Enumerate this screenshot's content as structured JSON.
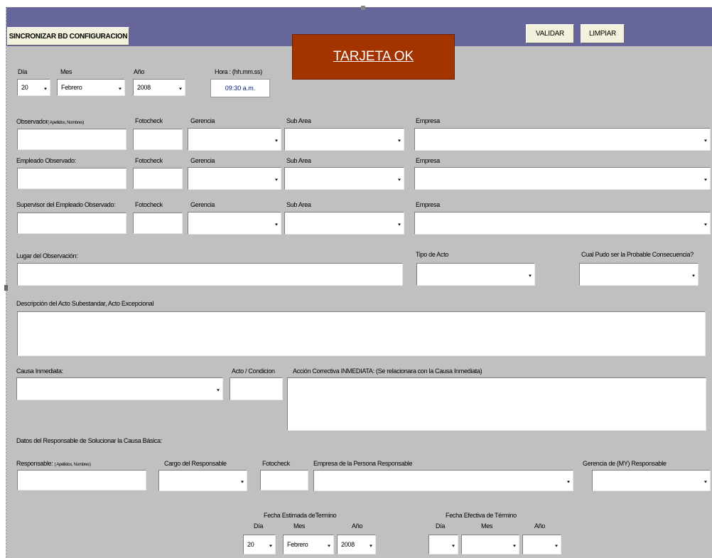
{
  "toolbar": {
    "sync_label": "SINCRONIZAR BD CONFIGURACION",
    "validate_label": "VALIDAR",
    "clear_label": "LIMPIAR",
    "status_banner": "TARJETA OK"
  },
  "date": {
    "day_label": "Día",
    "month_label": "Mes",
    "year_label": "Año",
    "time_label": "Hora : (hh.mm.ss)",
    "day_value": "20",
    "month_value": "Febrero",
    "year_value": "2008",
    "time_value": "09:30 a.m."
  },
  "observer": {
    "name_label_main": "Observador",
    "name_label_hint": "( Apellidos, Nombres)",
    "fotocheck_label": "Fotocheck",
    "gerencia_label": "Gerencia",
    "subarea_label": "Sub Area",
    "empresa_label": "Empresa"
  },
  "employee": {
    "name_label": "Empleado Observado:",
    "fotocheck_label": "Fotocheck",
    "gerencia_label": "Gerencia",
    "subarea_label": "Sub Area",
    "empresa_label": "Empresa"
  },
  "supervisor": {
    "name_label": "Supervisor del Empleado Observado:",
    "fotocheck_label": "Fotocheck",
    "gerencia_label": "Gerencia",
    "subarea_label": "Sub Area",
    "empresa_label": "Empresa"
  },
  "observation": {
    "place_label": "Lugar del Observación:",
    "act_type_label": "Tipo de Acto",
    "consequence_label": "Cual Pudo ser la Probable Consecuencia?",
    "description_label": "Descripción del Acto Subestandar, Acto Excepcional"
  },
  "cause": {
    "immediate_label": "Causa Inmediata:",
    "act_condition_label": "Acto / Condicion",
    "corrective_label": "Acción Correctiva INMEDIATA: (Se relacionara con la Causa Inmediata)"
  },
  "responsible": {
    "section_label": "Datos del Responsable de Solucionar la Causa Básica:",
    "name_label_main": "Responsable:",
    "name_label_hint": "( Apellidos, Nombres)",
    "position_label": "Cargo del Responsable",
    "fotocheck_label": "Fotocheck",
    "company_label": "Empresa de la Persona Responsable",
    "management_label": "Gerencia de (MY) Responsable"
  },
  "estimated_date": {
    "title": "Fecha Estimada deTermino",
    "day_label": "Día",
    "month_label": "Mes",
    "year_label": "Año",
    "day_value": "20",
    "month_value": "Febrero",
    "year_value": "2008"
  },
  "actual_date": {
    "title": "Fecha Efectiva de Término",
    "day_label": "Día",
    "month_label": "Mes",
    "year_label": "Año",
    "day_value": "",
    "month_value": "",
    "year_value": ""
  },
  "colors": {
    "header_bar": "#66669a",
    "form_background": "#c0c0c0",
    "banner_background": "#a33400",
    "banner_text": "#ffffff"
  }
}
